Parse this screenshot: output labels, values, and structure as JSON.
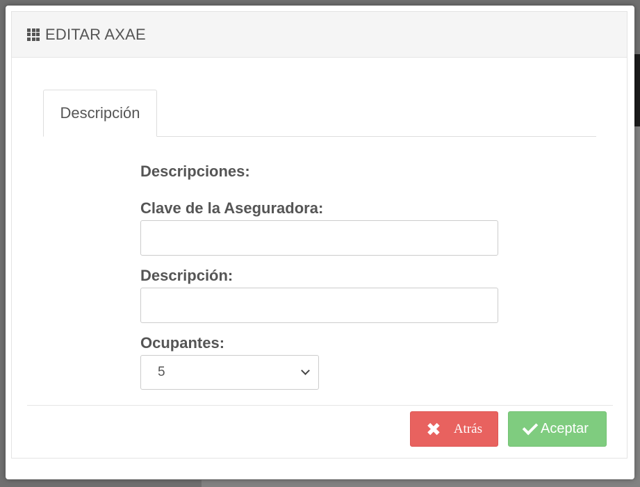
{
  "modal": {
    "title": "EDITAR AXAE"
  },
  "tabs": [
    {
      "label": "Descripción"
    }
  ],
  "form": {
    "section_title": "Descripciones:",
    "clave_label": "Clave de la Aseguradora:",
    "clave_value": "",
    "descripcion_label": "Descripción:",
    "descripcion_value": "",
    "ocupantes_label": "Ocupantes:",
    "ocupantes_value": "5"
  },
  "footer": {
    "back_label": "Atrás",
    "accept_label": "Aceptar"
  },
  "colors": {
    "back_button": "#e8625f",
    "accept_button": "#7fcc7f",
    "header_bg": "#f5f5f5"
  },
  "icons": {
    "title": "grid-icon",
    "back": "close-icon",
    "accept": "check-icon",
    "select": "chevron-down-icon"
  }
}
